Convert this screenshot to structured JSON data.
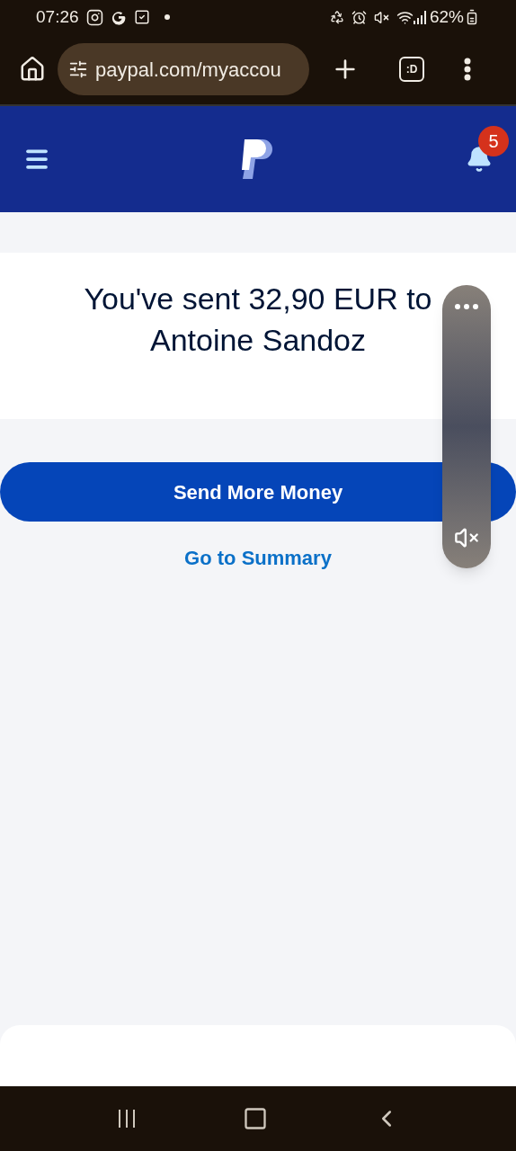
{
  "status_bar": {
    "time": "07:26",
    "battery": "62%"
  },
  "browser": {
    "url": "paypal.com/myaccou",
    "tabs_label": ":D"
  },
  "header": {
    "notifications": "5"
  },
  "confirmation": {
    "message": "You've sent 32,90 EUR to Antoine Sandoz"
  },
  "actions": {
    "primary": "Send More Money",
    "link": "Go to Summary"
  }
}
